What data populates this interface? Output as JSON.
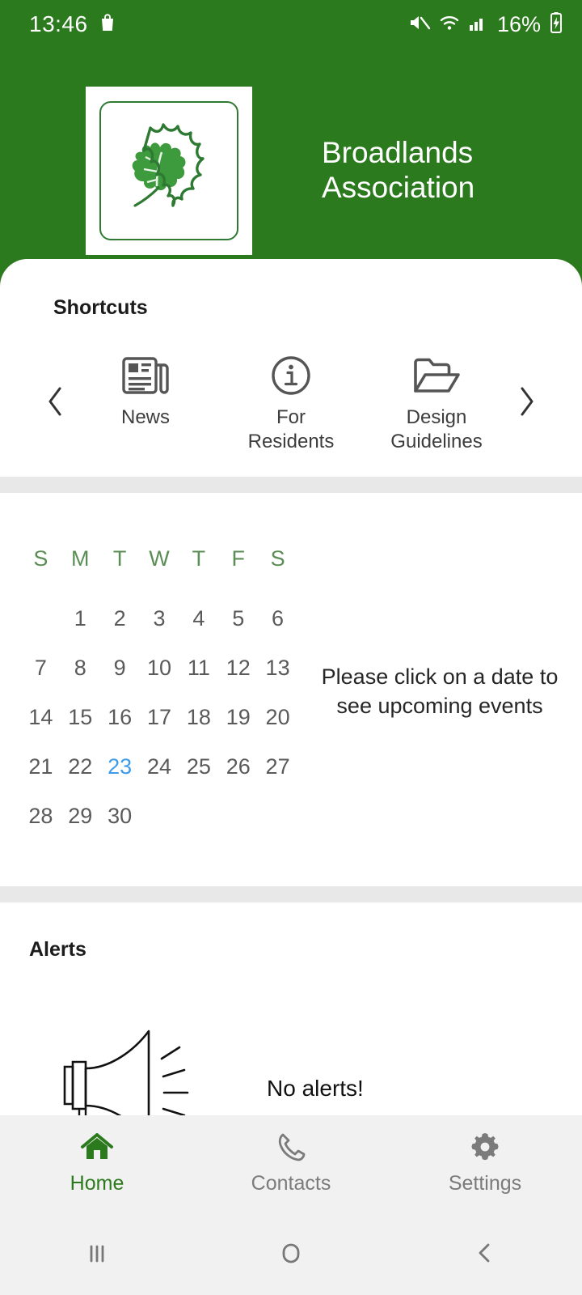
{
  "status_bar": {
    "time": "13:46",
    "battery_text": "16%",
    "icons": [
      "shopping-bag-icon",
      "mute-icon",
      "wifi-icon",
      "cellular-signal-icon",
      "battery-charging-icon"
    ]
  },
  "header": {
    "title_line1": "Broadlands",
    "title_line2": "Association",
    "logo_name": "broadlands-leaf-logo",
    "background_color": "#2C7A1E"
  },
  "shortcuts": {
    "title": "Shortcuts",
    "prev_label": "‹",
    "next_label": "›",
    "items": [
      {
        "label": "News",
        "icon": "newspaper-icon"
      },
      {
        "label": "For\nResidents",
        "label_line1": "For",
        "label_line2": "Residents",
        "icon": "info-circle-icon"
      },
      {
        "label": "Design\nGuidelines",
        "label_line1": "Design",
        "label_line2": "Guidelines",
        "icon": "open-folder-icon"
      }
    ]
  },
  "calendar": {
    "day_headers": [
      "S",
      "M",
      "T",
      "W",
      "T",
      "F",
      "S"
    ],
    "leading_blanks": 1,
    "days": [
      1,
      2,
      3,
      4,
      5,
      6,
      7,
      8,
      9,
      10,
      11,
      12,
      13,
      14,
      15,
      16,
      17,
      18,
      19,
      20,
      21,
      22,
      23,
      24,
      25,
      26,
      27,
      28,
      29,
      30
    ],
    "selected_day": 23,
    "selected_color": "#3E9BE8",
    "header_color": "#5B8E55",
    "message_line1": "Please click on a date to",
    "message_line2": "see upcoming events"
  },
  "alerts": {
    "title": "Alerts",
    "empty_message": "No alerts!",
    "icon": "megaphone-icon"
  },
  "bottom_nav": {
    "items": [
      {
        "label": "Home",
        "icon": "home-icon",
        "active": true
      },
      {
        "label": "Contacts",
        "icon": "phone-icon",
        "active": false
      },
      {
        "label": "Settings",
        "icon": "gear-icon",
        "active": false
      }
    ],
    "active_color": "#2C7A1E"
  },
  "system_nav": {
    "recents": "recents-icon",
    "home": "home-circle-icon",
    "back": "back-chevron-icon"
  }
}
